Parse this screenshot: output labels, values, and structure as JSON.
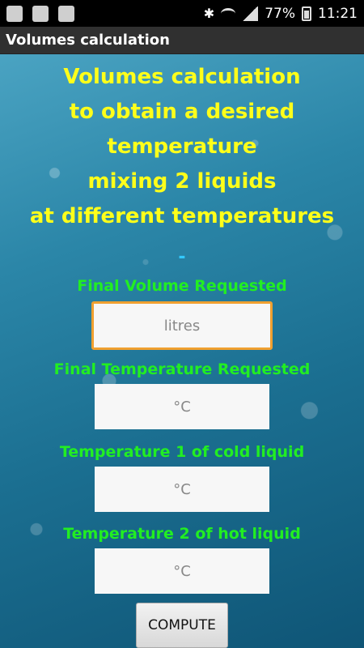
{
  "status_bar": {
    "battery": "77%",
    "time": "11:21"
  },
  "app": {
    "title": "Volumes calculation"
  },
  "heading": {
    "line1": "Volumes calculation",
    "line2": "to obtain a desired",
    "line3": "temperature",
    "line4": "mixing 2 liquids",
    "line5": "at different temperatures",
    "separator": "-"
  },
  "form": {
    "volume_label": "Final Volume Requested",
    "volume_placeholder": "litres",
    "final_temp_label": "Final Temperature Requested",
    "final_temp_placeholder": "°C",
    "temp1_label": "Temperature 1 of cold liquid",
    "temp1_placeholder": "°C",
    "temp2_label": "Temperature 2 of hot liquid",
    "temp2_placeholder": "°C",
    "compute_label": "COMPUTE"
  },
  "colors": {
    "heading": "#ffff1a",
    "label": "#22ee22",
    "focus_border": "#f0a030"
  }
}
